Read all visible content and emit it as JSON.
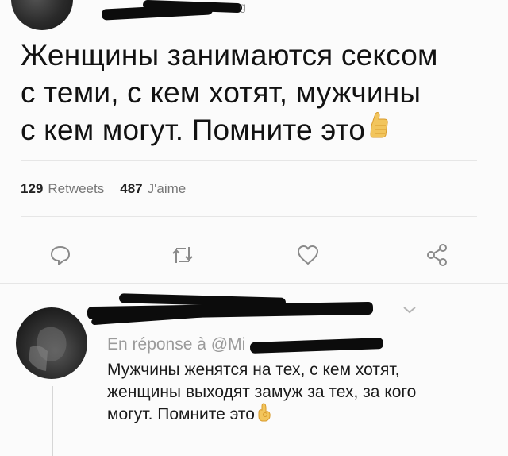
{
  "tweet": {
    "handle_suffix": "g",
    "text_line1": "Женщины занимаются сексом",
    "text_line2": "с теми, с кем хотят, мужчины",
    "text_line3": "с кем могут. Помните это",
    "emoji": "thumbs-up-emoji"
  },
  "stats": {
    "retweets_count": "129",
    "retweets_label": "Retweets",
    "likes_count": "487",
    "likes_label": "J'aime"
  },
  "actions": [
    "reply-icon",
    "retweet-icon",
    "like-icon",
    "share-icon"
  ],
  "reply": {
    "reply_to_label": "En réponse à @Mi",
    "text_line1": "Мужчины женятся на тех, с кем хотят,",
    "text_line2": "женщины выходят замуж за тех, за кого",
    "text_line3": "могут. Помните это",
    "emoji": "ok-hand-emoji"
  },
  "colors": {
    "background": "#fbfbfb",
    "text": "#121212",
    "muted": "#9b9b9b",
    "divider": "#e6e6e6",
    "redaction": "#0c0c0c"
  }
}
